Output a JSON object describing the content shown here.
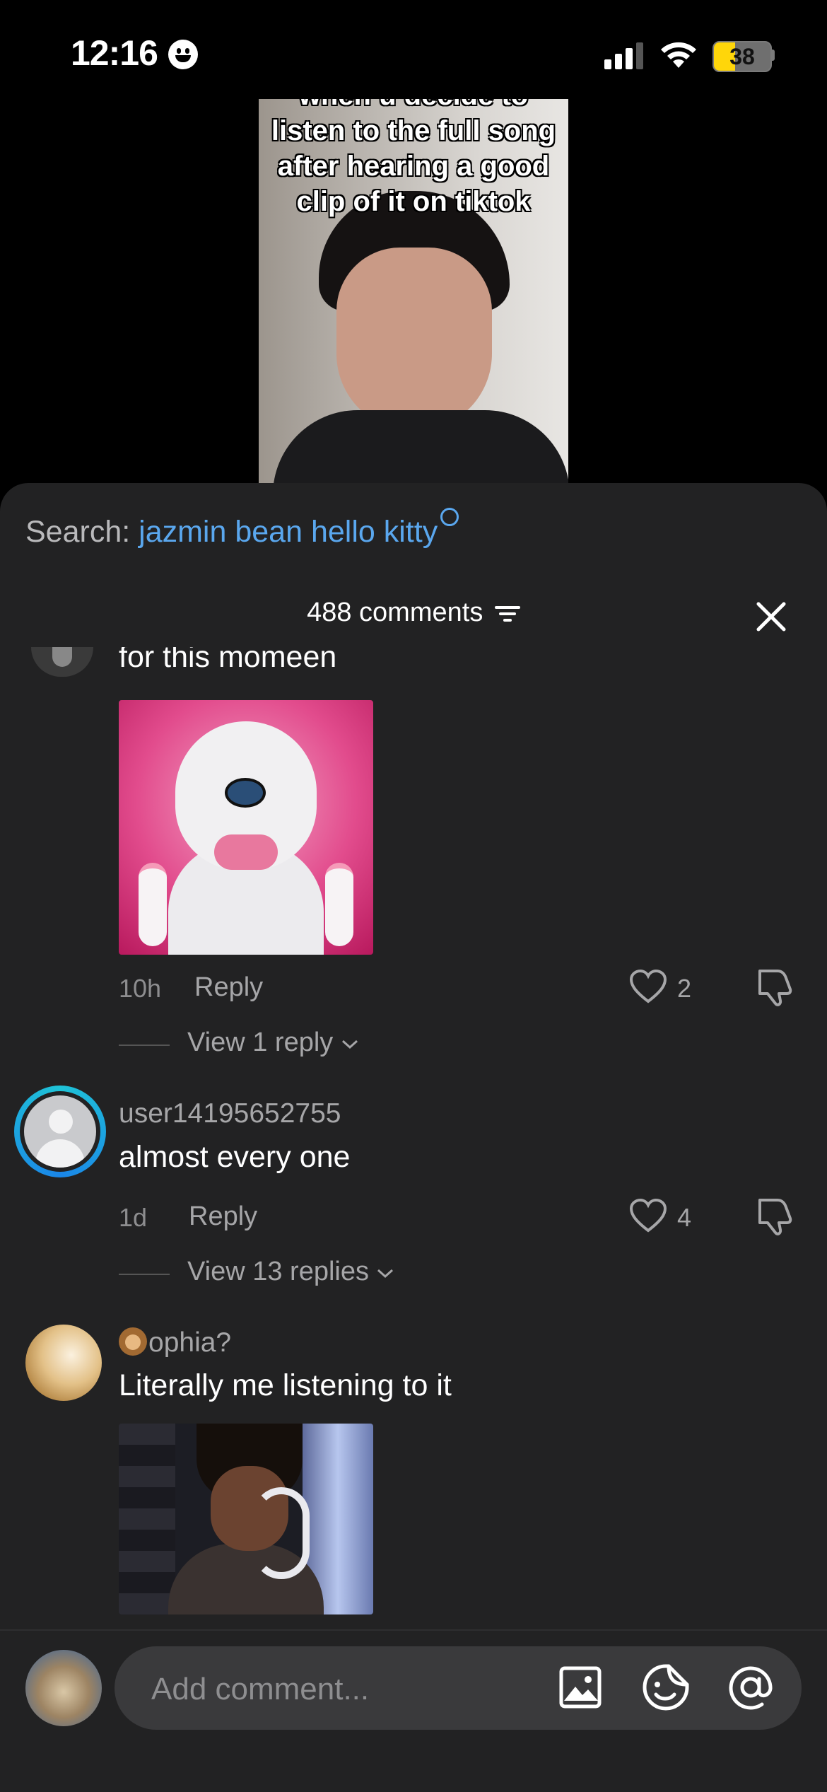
{
  "status_bar": {
    "time": "12:16",
    "battery_level": "38",
    "battery_fraction": 0.38
  },
  "video": {
    "caption_cut": "when u decide to",
    "caption_lines": [
      "listen to the full song",
      "after hearing a good",
      "clip of it on tiktok"
    ]
  },
  "search": {
    "prefix": "Search: ",
    "term": "jazmin bean hello kitty"
  },
  "comments_header": {
    "count_label": "488 comments"
  },
  "comments": [
    {
      "text": "for this momeen",
      "time": "10h",
      "reply_label": "Reply",
      "likes": "2",
      "view_replies": "View 1 reply"
    },
    {
      "user": "user14195652755",
      "text": "almost every one",
      "time": "1d",
      "reply_label": "Reply",
      "likes": "4",
      "view_replies": "View 13 replies"
    },
    {
      "user": "ophia?",
      "text": "Literally me listening to it"
    }
  ],
  "composer": {
    "placeholder": "Add comment..."
  },
  "colors": {
    "accent_search": "#5aa7ee",
    "sheet_bg": "#222223",
    "battery_yellow": "#ffd60a"
  },
  "icons": [
    "smiley-icon",
    "signal-icon",
    "wifi-icon",
    "battery-icon",
    "filter-icon",
    "close-icon",
    "heart-icon",
    "dislike-icon",
    "chevron-down-icon",
    "image-icon",
    "sticker-icon",
    "mention-icon"
  ]
}
